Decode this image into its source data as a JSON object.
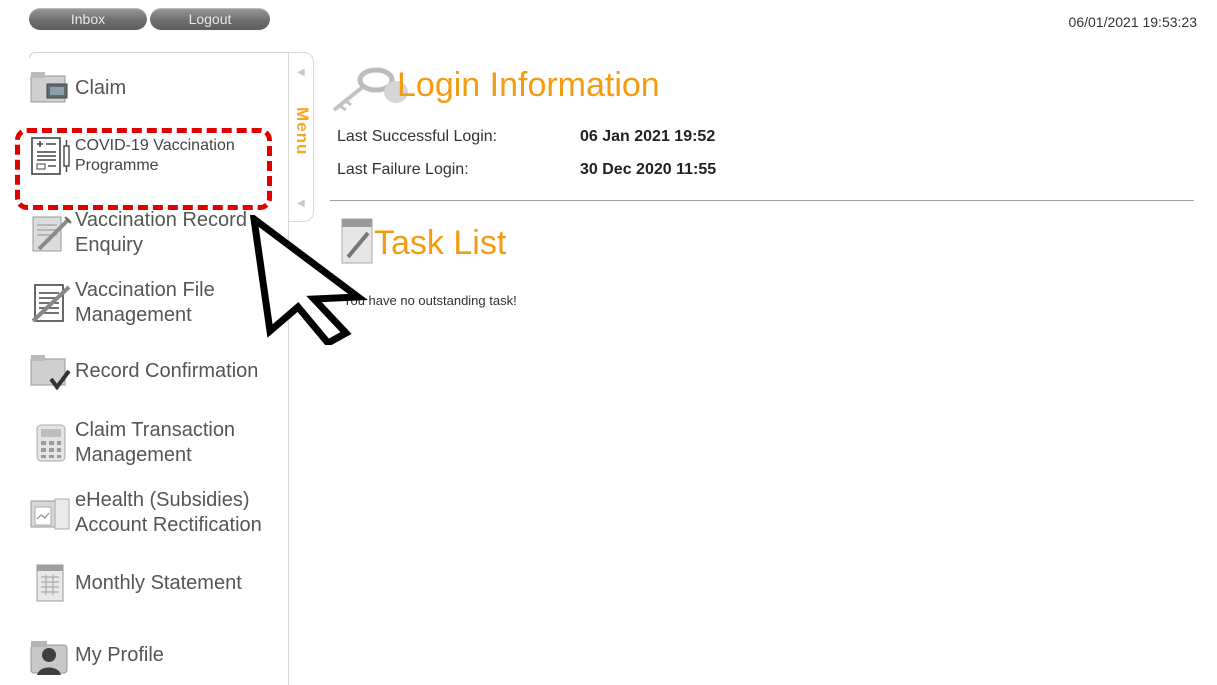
{
  "header": {
    "inbox_label": "Inbox",
    "logout_label": "Logout",
    "datetime": "06/01/2021 19:53:23"
  },
  "sidebar": {
    "tab_label": "Menu",
    "items": [
      {
        "label": "Claim",
        "icon": "claim-icon"
      },
      {
        "label_line1": "COVID-19 Vaccination",
        "label_line2": "Programme",
        "icon": "vaccination-form-icon",
        "highlighted": true
      },
      {
        "label_line1": "Vaccination Record",
        "label_line2": "Enquiry",
        "icon": "record-enquiry-icon"
      },
      {
        "label_line1": "Vaccination File",
        "label_line2": "Management",
        "icon": "file-management-icon"
      },
      {
        "label": "Record Confirmation",
        "icon": "record-confirmation-icon"
      },
      {
        "label_line1": "Claim Transaction",
        "label_line2": "Management",
        "icon": "calculator-icon"
      },
      {
        "label_line1": "eHealth (Subsidies)",
        "label_line2": "Account Rectification",
        "icon": "account-rectification-icon"
      },
      {
        "label": "Monthly Statement",
        "icon": "statement-icon"
      },
      {
        "label": "My Profile",
        "icon": "profile-icon"
      }
    ]
  },
  "login_info": {
    "title": "Login Information",
    "last_success_label": "Last Successful Login:",
    "last_success_value": "06 Jan 2021 19:52",
    "last_failure_label": "Last Failure Login:",
    "last_failure_value": "30 Dec 2020 11:55"
  },
  "task_list": {
    "title": "Task List",
    "message": "You have no outstanding task!"
  },
  "colors": {
    "accent": "#f39c12",
    "highlight": "#e00000",
    "button": "#7a7a7a"
  }
}
